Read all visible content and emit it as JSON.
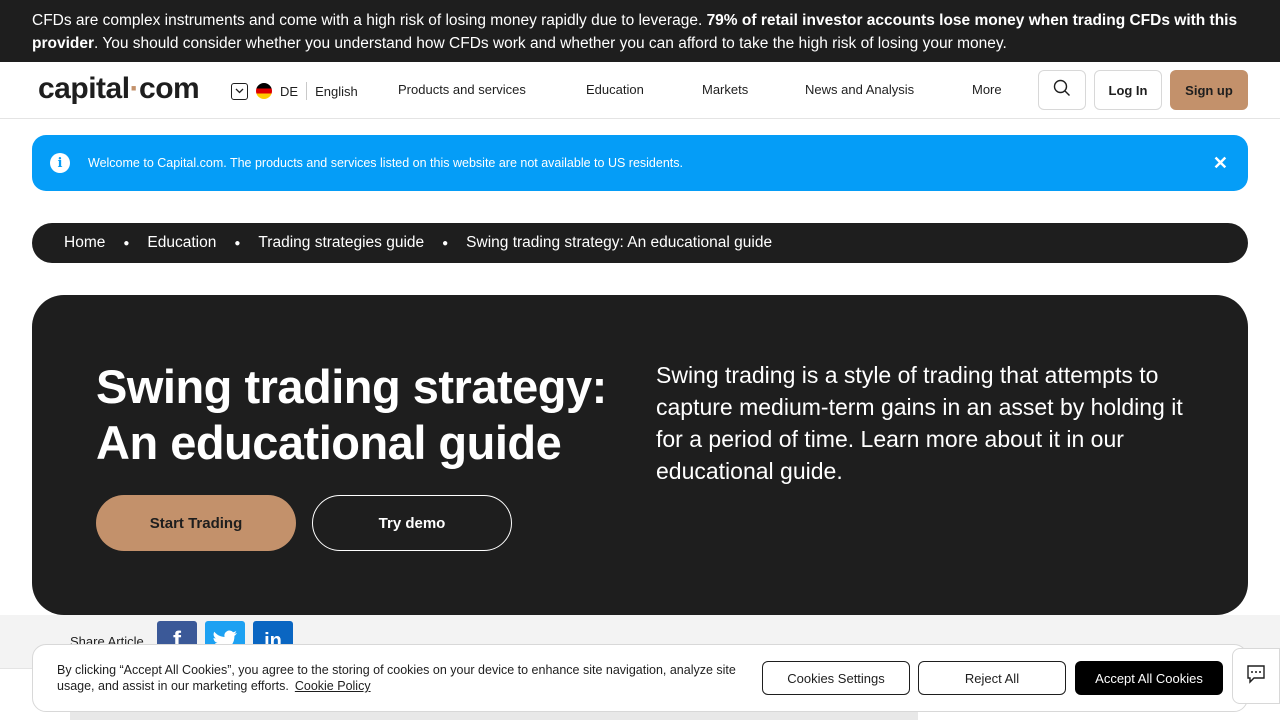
{
  "risk_warning": {
    "text_1": "CFDs are complex instruments and come with a high risk of losing money rapidly due to leverage. ",
    "bold": "79% of retail investor accounts lose money when trading CFDs with this provider",
    "text_2": ". You should consider whether you understand how CFDs work and whether you can afford to take the high risk of losing your money."
  },
  "header": {
    "logo_left": "capital",
    "logo_dot": "·",
    "logo_right": "com",
    "region_code": "DE",
    "language": "English",
    "nav": [
      "Products and services",
      "Education",
      "Markets",
      "News and Analysis",
      "More"
    ],
    "login_label": "Log In",
    "signup_label": "Sign up"
  },
  "notice": {
    "text": "Welcome to Capital.com. The products and services listed on this website are not available to US residents.",
    "info_glyph": "i",
    "close_glyph": "✕"
  },
  "breadcrumb": [
    "Home",
    "Education",
    "Trading strategies guide",
    "Swing trading strategy: An educational guide"
  ],
  "hero": {
    "title": "Swing trading strategy: An educational guide",
    "description": "Swing trading is a style of trading that attempts to capture medium-term gains in an asset by holding it for a period of time. Learn more about it in our educational guide.",
    "start_label": "Start Trading",
    "demo_label": "Try demo"
  },
  "share": {
    "label": "Share Article",
    "networks": [
      "f",
      "t",
      "in"
    ]
  },
  "cookie": {
    "text": "By clicking “Accept All Cookies”, you agree to the storing of cookies on your device to enhance site navigation, analyze site usage, and assist in our marketing efforts.",
    "policy_link": "Cookie Policy",
    "settings_label": "Cookies Settings",
    "reject_label": "Reject All",
    "accept_label": "Accept All Cookies"
  },
  "colors": {
    "accent": "#c3916b",
    "dark": "#1e1e1e",
    "notice_blue": "#059df7"
  }
}
